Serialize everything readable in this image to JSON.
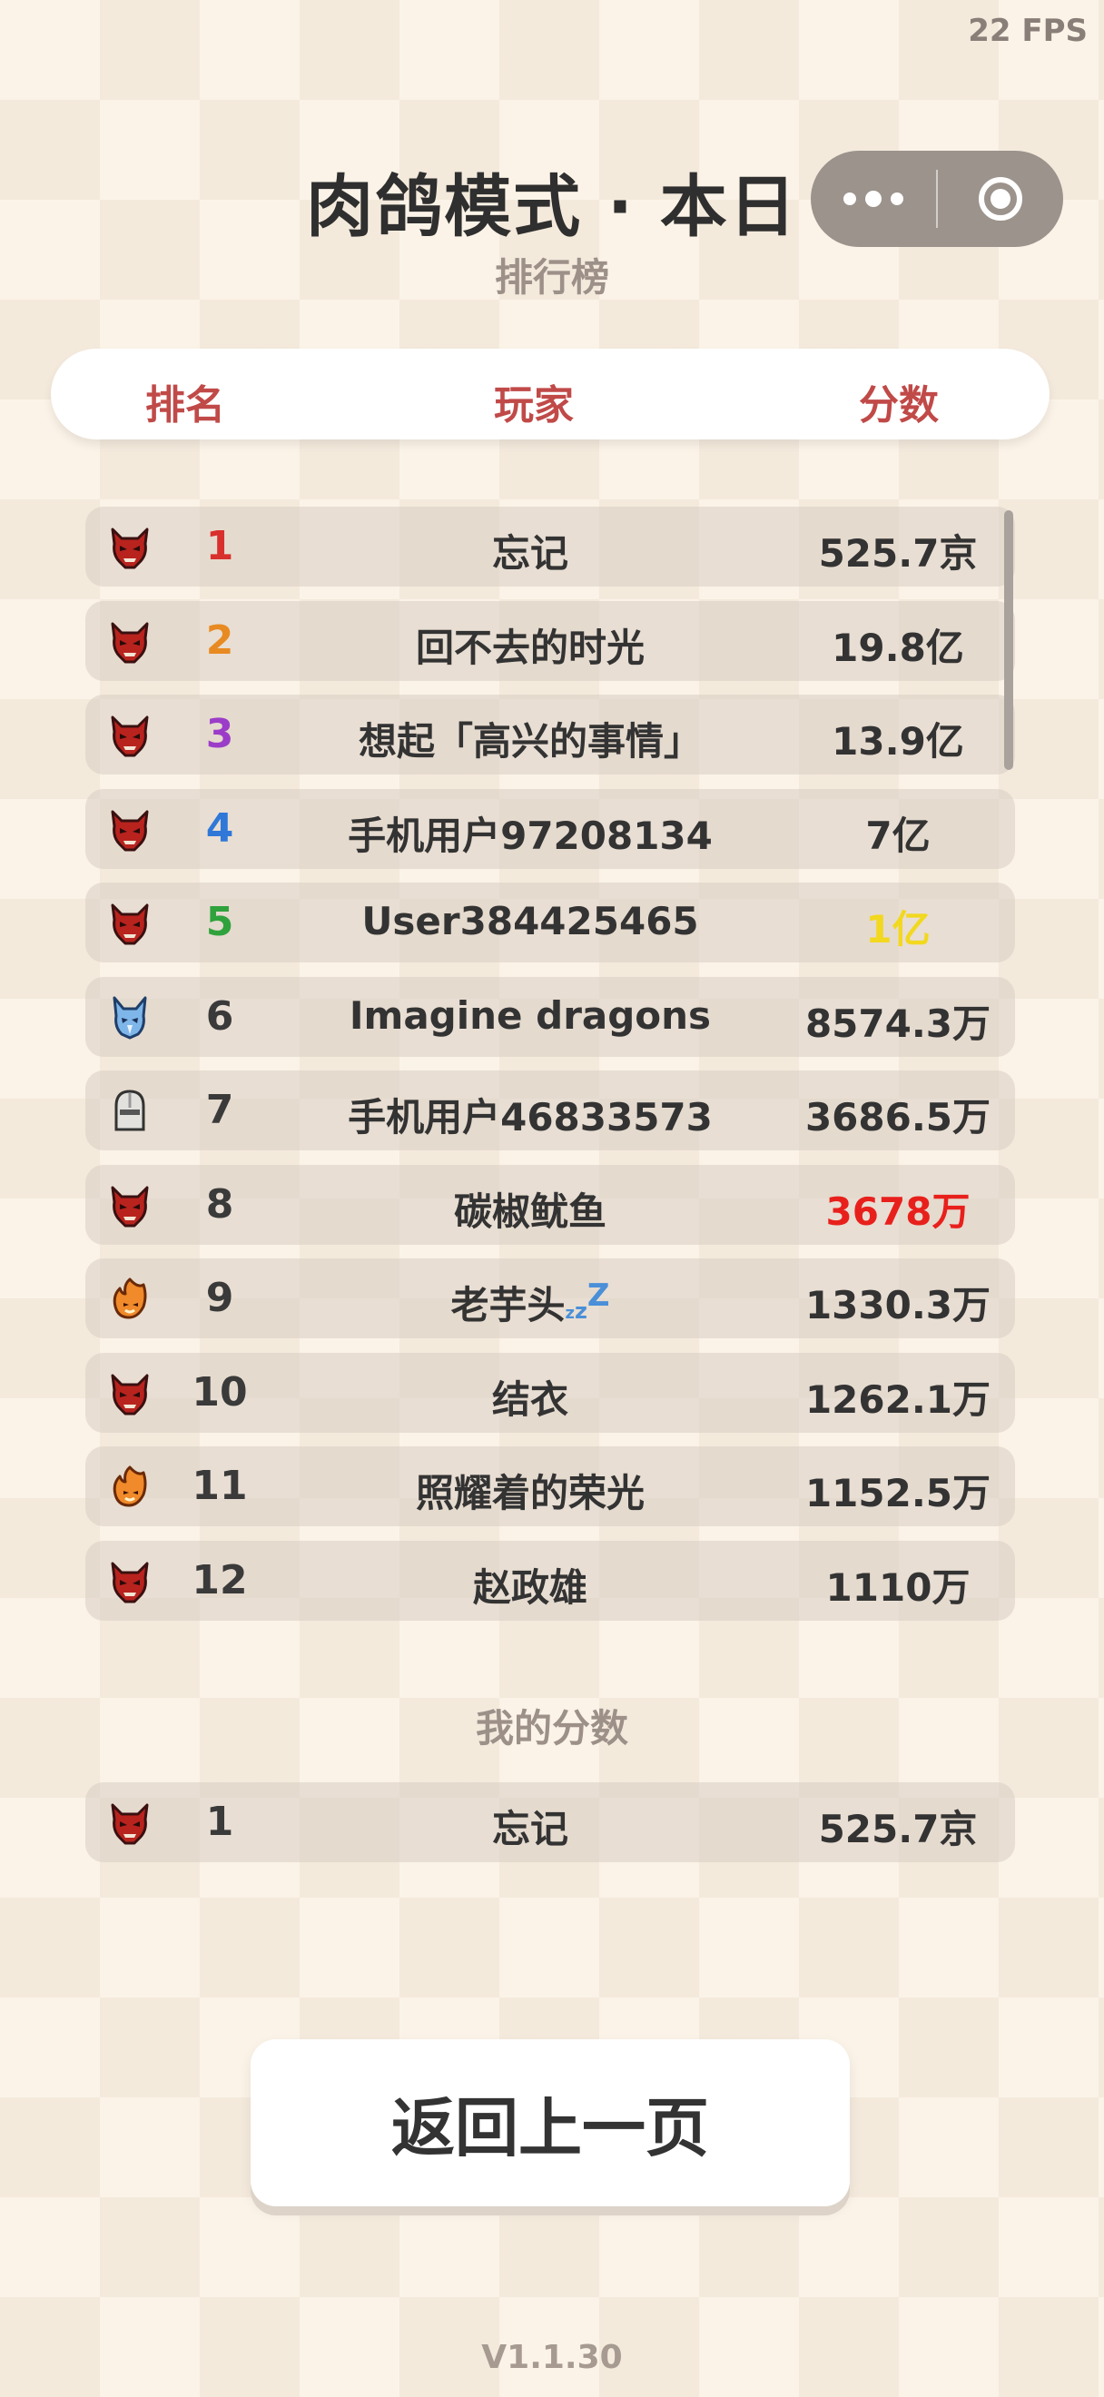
{
  "fps": "22 FPS",
  "header": {
    "title": "肉鸽模式 · 本日",
    "subtitle": "排行榜"
  },
  "columns": {
    "rank": "排名",
    "player": "玩家",
    "score": "分数"
  },
  "rows": [
    {
      "rank": "1",
      "name": "忘记",
      "score": "525.7京",
      "icon": "red-demon-icon",
      "rank_color": "#d8302c",
      "score_color": "#333333"
    },
    {
      "rank": "2",
      "name": "回不去的时光",
      "score": "19.8亿",
      "icon": "red-demon-icon",
      "rank_color": "#e88a22",
      "score_color": "#333333"
    },
    {
      "rank": "3",
      "name": "想起「高兴的事情」",
      "score": "13.9亿",
      "icon": "red-demon-icon",
      "rank_color": "#9b3dc8",
      "score_color": "#333333"
    },
    {
      "rank": "4",
      "name": "手机用户97208134",
      "score": "7亿",
      "icon": "red-demon-icon",
      "rank_color": "#2f78d8",
      "score_color": "#333333"
    },
    {
      "rank": "5",
      "name": "User384425465",
      "score": "1亿",
      "icon": "red-demon-icon",
      "rank_color": "#2fa23c",
      "score_color": "#f2d81e"
    },
    {
      "rank": "6",
      "name": "Imagine dragons",
      "score": "8574.3万",
      "icon": "blue-dragon-icon",
      "rank_color": "#3a3a3a",
      "score_color": "#333333"
    },
    {
      "rank": "7",
      "name": "手机用户46833573",
      "score": "3686.5万",
      "icon": "knight-helmet-icon",
      "rank_color": "#3a3a3a",
      "score_color": "#333333"
    },
    {
      "rank": "8",
      "name": "碳椒鱿鱼",
      "score": "3678万",
      "icon": "red-demon-icon",
      "rank_color": "#3a3a3a",
      "score_color": "#e8201c"
    },
    {
      "rank": "9",
      "name": "老芋头",
      "score": "1330.3万",
      "icon": "fire-spirit-icon",
      "rank_color": "#3a3a3a",
      "score_color": "#333333",
      "suffix": "zzZ"
    },
    {
      "rank": "10",
      "name": "结衣",
      "score": "1262.1万",
      "icon": "red-demon-icon",
      "rank_color": "#3a3a3a",
      "score_color": "#333333"
    },
    {
      "rank": "11",
      "name": "照耀着的荣光",
      "score": "1152.5万",
      "icon": "fire-spirit-icon",
      "rank_color": "#3a3a3a",
      "score_color": "#333333"
    },
    {
      "rank": "12",
      "name": "赵政雄",
      "score": "1110万",
      "icon": "red-demon-icon",
      "rank_color": "#3a3a3a",
      "score_color": "#333333"
    }
  ],
  "my_score": {
    "label": "我的分数",
    "rank": "1",
    "name": "忘记",
    "score": "525.7京",
    "icon": "red-demon-icon"
  },
  "back_button": "返回上一页",
  "version": "V1.1.30"
}
